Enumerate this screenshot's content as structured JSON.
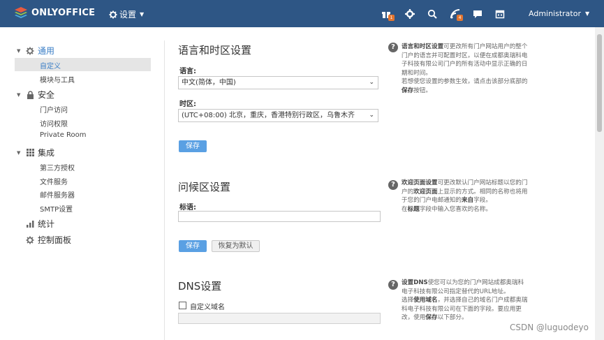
{
  "header": {
    "logo_text": "ONLYOFFICE",
    "settings_label": "设置",
    "user_name": "Administrator",
    "badges": {
      "calendar": "1",
      "feed": "4"
    },
    "bg_color": "#2e5685"
  },
  "sidebar": {
    "groups": [
      {
        "label": "通用",
        "icon": "gear-icon",
        "expanded": true,
        "items": [
          "自定义",
          "模块与工具"
        ]
      },
      {
        "label": "安全",
        "icon": "lock-icon",
        "expanded": true,
        "items": [
          "门户访问",
          "访问权限",
          "Private Room"
        ]
      },
      {
        "label": "集成",
        "icon": "grid-icon",
        "expanded": true,
        "items": [
          "第三方授权",
          "文件服务",
          "邮件服务器",
          "SMTP设置"
        ]
      },
      {
        "label": "统计",
        "icon": "bar-chart-icon",
        "expanded": false,
        "items": []
      },
      {
        "label": "控制面板",
        "icon": "gear-icon",
        "expanded": false,
        "items": []
      }
    ],
    "selected": "自定义"
  },
  "lang_section": {
    "title": "语言和时区设置",
    "lang_label": "语言:",
    "lang_value": "中文(简体，中国)",
    "tz_label": "时区:",
    "tz_value": "(UTC+08:00) 北京，重庆，香港特别行政区，乌鲁木齐",
    "save_label": "保存",
    "help": {
      "b1": "语言和时区设置",
      "t1": "可更改所有门户网站用户的整个门户的语言并可配置时区，以便在成都奥瑞科电子科技有限公司门户的所有活动中显示正确的日期和时间。",
      "t2": "若想使您设置的参数生效，请点击该部分底部的",
      "b2": "保存",
      "t3": "按钮。"
    }
  },
  "greeting_section": {
    "title": "问候区设置",
    "title_label": "标语:",
    "title_value": "",
    "save_label": "保存",
    "restore_label": "恢复为默认",
    "help": {
      "b1": "欢迎页面设置",
      "t1": "可更改默认门户网站标题以您的门户的",
      "b2": "欢迎页面",
      "t2": "上显示的方式。相同的名称也将用于您的门户电邮通知的",
      "b3": "来自",
      "t3": "字段。",
      "t4": "在",
      "b4": "标题",
      "t5": "字段中输入您喜欢的名称。"
    }
  },
  "dns_section": {
    "title": "DNS设置",
    "checkbox_label": "自定义域名",
    "checked": false,
    "domain_value": "",
    "help": {
      "b1": "设置DNS",
      "t1": "使您可以为您的门户网站成都奥瑞科电子科技有限公司指定替代的URL地址。",
      "t2": "选择",
      "b2": "使用域名",
      "t3": "，并选择自己的域名门户成都奥瑞科电子科技有限公司在下面的字段",
      "t4": "。要应用更改，使用",
      "b3": "保存",
      "t5": "以下部分。"
    }
  },
  "watermark": "CSDN @luguodeyo"
}
